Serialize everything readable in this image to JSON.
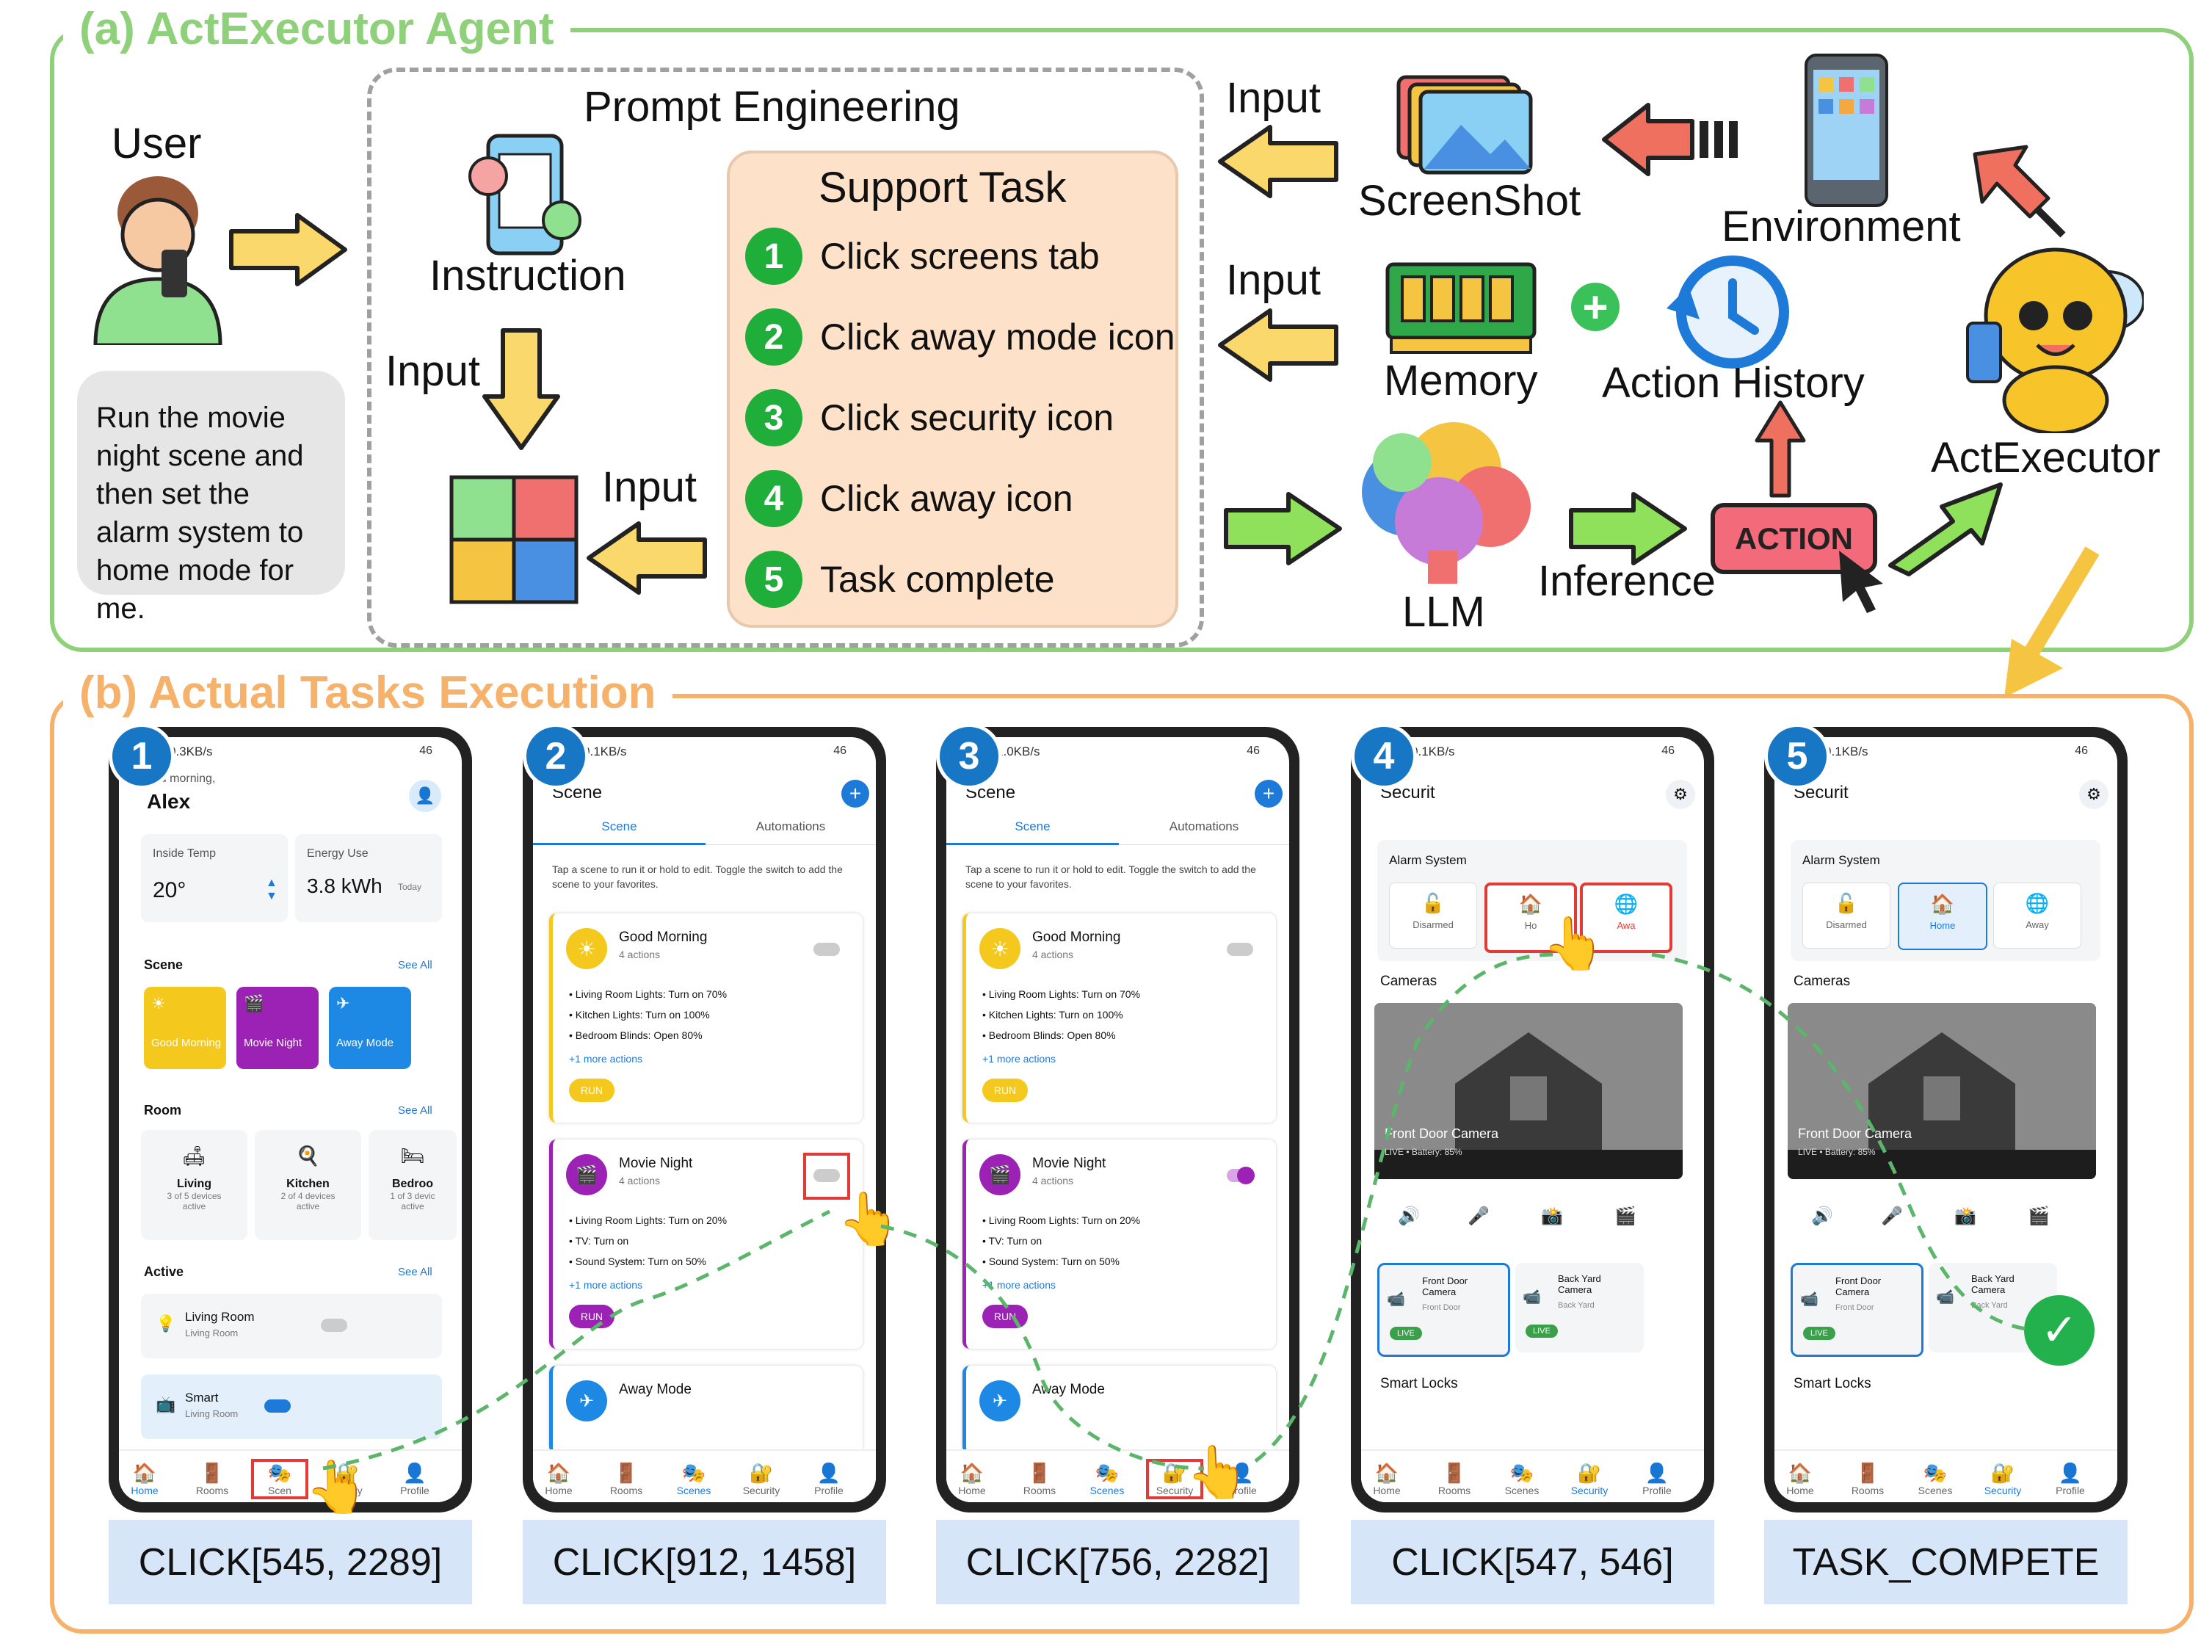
{
  "panel_a": {
    "title": "(a) ActExecutor Agent",
    "user_label": "User",
    "user_request": "Run the movie night scene and then set the alarm system to home mode for me.",
    "prompt_engineering_label": "Prompt Engineering",
    "instruction_label": "Instruction",
    "input_label": "Input",
    "support_task_title": "Support Task",
    "support_steps": [
      {
        "num": "1",
        "text": "Click screens tab"
      },
      {
        "num": "2",
        "text": "Click away mode icon"
      },
      {
        "num": "3",
        "text": "Click security icon"
      },
      {
        "num": "4",
        "text": "Click away icon"
      },
      {
        "num": "5",
        "text": "Task complete"
      }
    ],
    "screenshot_label": "ScreenShot",
    "environment_label": "Environment",
    "memory_label": "Memory",
    "action_history_label": "Action History",
    "llm_label": "LLM",
    "inference_label": "Inference",
    "action_label": "ACTION",
    "actexecutor_label": "ActExecutor"
  },
  "panel_b": {
    "title": "(b) Actual Tasks Execution",
    "steps": [
      {
        "num": "1",
        "action": "CLICK[545, 2289]"
      },
      {
        "num": "2",
        "action": "CLICK[912, 1458]"
      },
      {
        "num": "3",
        "action": "CLICK[756, 2282]"
      },
      {
        "num": "4",
        "action": "CLICK[547, 546]"
      },
      {
        "num": "5",
        "action": "TASK_COMPETE"
      }
    ]
  },
  "phones": {
    "status_1": "M | 0.3KB/s",
    "status_2": "M | 0.1KB/s",
    "status_3": "M | 1.0KB/s",
    "status_4": "M | 0.1KB/s",
    "status_5": "M | 0.1KB/s",
    "status_right": "46",
    "home": {
      "greeting": "ood morning,",
      "name": "Alex",
      "temp_label": "Inside Temp",
      "temp_value": "20°",
      "energy_label": "Energy Use",
      "energy_value": "3.8 kWh",
      "energy_period": "Today",
      "scene_label": "Scene",
      "see_all": "See All",
      "scene_tiles": [
        "Good Morning",
        "Movie Night",
        "Away Mode"
      ],
      "room_label": "Room",
      "rooms": [
        {
          "name": "Living",
          "devices": "3 of 5 devices",
          "state": "active"
        },
        {
          "name": "Kitchen",
          "devices": "2 of 4 devices",
          "state": "active"
        },
        {
          "name": "Bedroo",
          "devices": "1 of 3 devic",
          "state": "active"
        }
      ],
      "active_label": "Active",
      "active_items": [
        {
          "name": "Living Room",
          "sub": "Living Room"
        },
        {
          "name": "Smart",
          "sub": "Living Room"
        }
      ]
    },
    "nav": [
      "Home",
      "Rooms",
      "Scenes",
      "Security",
      "Profile"
    ],
    "nav_short_1": [
      "Home",
      "Rooms",
      "Scen",
      "ecurity",
      "Profile"
    ],
    "scene": {
      "title": "Scene",
      "tabs": [
        "Scene",
        "Automations"
      ],
      "hint": "Tap a scene to run it or hold to edit. Toggle the switch to add the scene to your favorites.",
      "good_morning": {
        "name": "Good Morning",
        "count": "4 actions",
        "items": [
          "Living Room Lights: Turn on 70%",
          "Kitchen Lights: Turn on 100%",
          "Bedroom Blinds: Open 80%"
        ],
        "more": "+1 more actions",
        "run": "RUN"
      },
      "movie_night": {
        "name": "Movie Night",
        "count": "4 actions",
        "items": [
          "Living Room Lights: Turn on 20%",
          "TV: Turn on",
          "Sound System: Turn on 50%"
        ],
        "more": "+1 more actions",
        "run": "RUN"
      },
      "away": {
        "name": "Away Mode"
      }
    },
    "security": {
      "title": "Securit",
      "alarm_label": "Alarm System",
      "modes": [
        "Disarmed",
        "Home",
        "Away"
      ],
      "modes_partial": [
        "Disarmed",
        "Ho",
        "Awa"
      ],
      "cameras_label": "Cameras",
      "camera_title": "Front Door Camera",
      "camera_status": "LIVE  •  Battery: 85%",
      "camera_cards": [
        {
          "name": "Front Door Camera",
          "loc": "Front Door",
          "badge": "LIVE"
        },
        {
          "name": "Back Yard Camera",
          "loc": "Back Yard",
          "badge": "LIVE"
        }
      ],
      "locks_label": "Smart Locks"
    }
  }
}
